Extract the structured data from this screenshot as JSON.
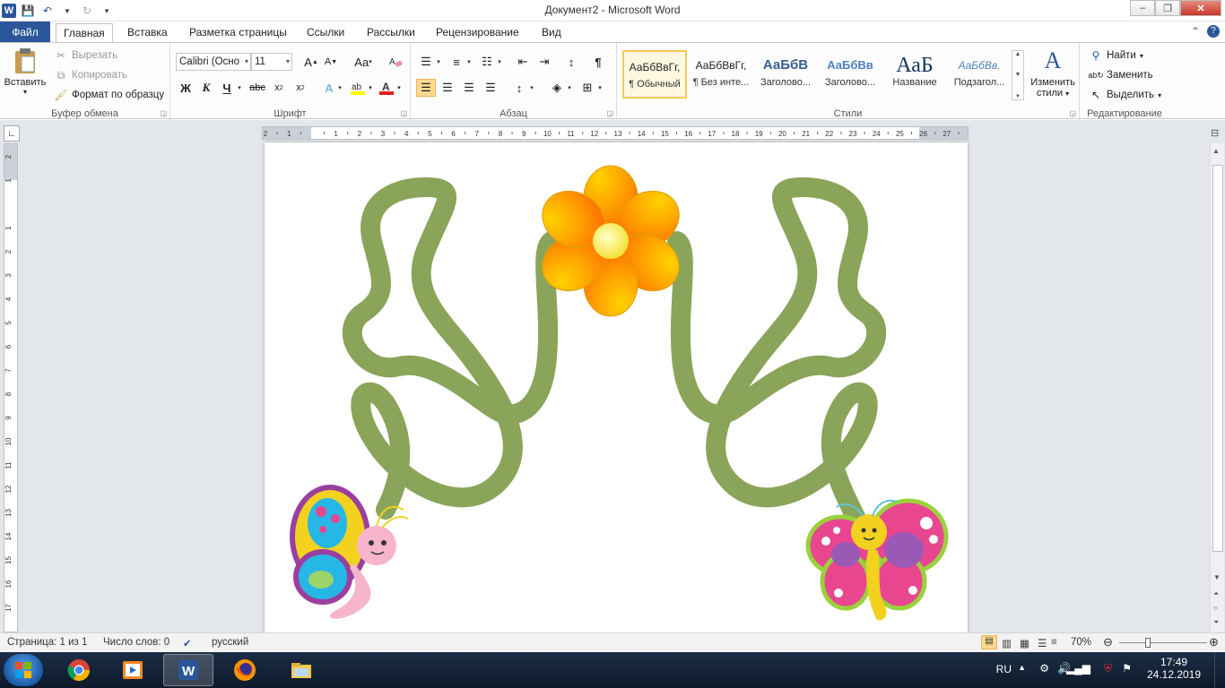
{
  "window": {
    "title": "Документ2 - Microsoft Word",
    "minimize": "–",
    "maximize": "❐",
    "close": "✕"
  },
  "tabs": [
    "Файл",
    "Главная",
    "Вставка",
    "Разметка страницы",
    "Ссылки",
    "Рассылки",
    "Рецензирование",
    "Вид"
  ],
  "clipboard": {
    "paste": "Вставить",
    "cut": "Вырезать",
    "copy": "Копировать",
    "format_painter": "Формат по образцу",
    "label": "Буфер обмена"
  },
  "font": {
    "name": "Calibri (Осно",
    "size": "11",
    "label": "Шрифт",
    "bold": "Ж",
    "italic": "К",
    "underline": "Ч",
    "strike": "abc",
    "change_case": "Aa"
  },
  "paragraph": {
    "label": "Абзац"
  },
  "styles": {
    "label": "Стили",
    "items": [
      {
        "sample": "АаБбВвГг,",
        "name": "¶ Обычный"
      },
      {
        "sample": "АаБбВвГг,",
        "name": "¶ Без инте..."
      },
      {
        "sample": "АаБбВ",
        "name": "Заголово..."
      },
      {
        "sample": "АаБбВв",
        "name": "Заголово..."
      },
      {
        "sample": "АаБ",
        "name": "Название"
      },
      {
        "sample": "АаБбВв.",
        "name": "Подзагол..."
      }
    ],
    "change_styles_line1": "Изменить",
    "change_styles_line2": "стили"
  },
  "editing": {
    "label": "Редактирование",
    "find": "Найти",
    "replace": "Заменить",
    "select": "Выделить"
  },
  "ruler": {
    "h_numbers": [
      "2",
      "1",
      "",
      "1",
      "2",
      "3",
      "4",
      "5",
      "6",
      "7",
      "8",
      "9",
      "10",
      "11",
      "12",
      "13",
      "14",
      "15",
      "16",
      "17",
      "18",
      "19",
      "20",
      "21",
      "22",
      "23",
      "24",
      "25",
      "26",
      "27"
    ],
    "v_numbers": [
      "2",
      "1",
      "",
      "1",
      "2",
      "3",
      "4",
      "5",
      "6",
      "7",
      "8",
      "9",
      "10",
      "11",
      "12",
      "13",
      "14",
      "15",
      "16",
      "17"
    ]
  },
  "statusbar": {
    "page": "Страница: 1 из 1",
    "words": "Число слов: 0",
    "language": "русский",
    "zoom": "70%"
  },
  "taskbar": {
    "lang": "RU",
    "time": "17:49",
    "date": "24.12.2019"
  },
  "colors": {
    "word_blue": "#2b579a",
    "vine_green": "#8aa45a",
    "flower_orange": "#ff7a00",
    "flower_yellow": "#ffd200"
  }
}
